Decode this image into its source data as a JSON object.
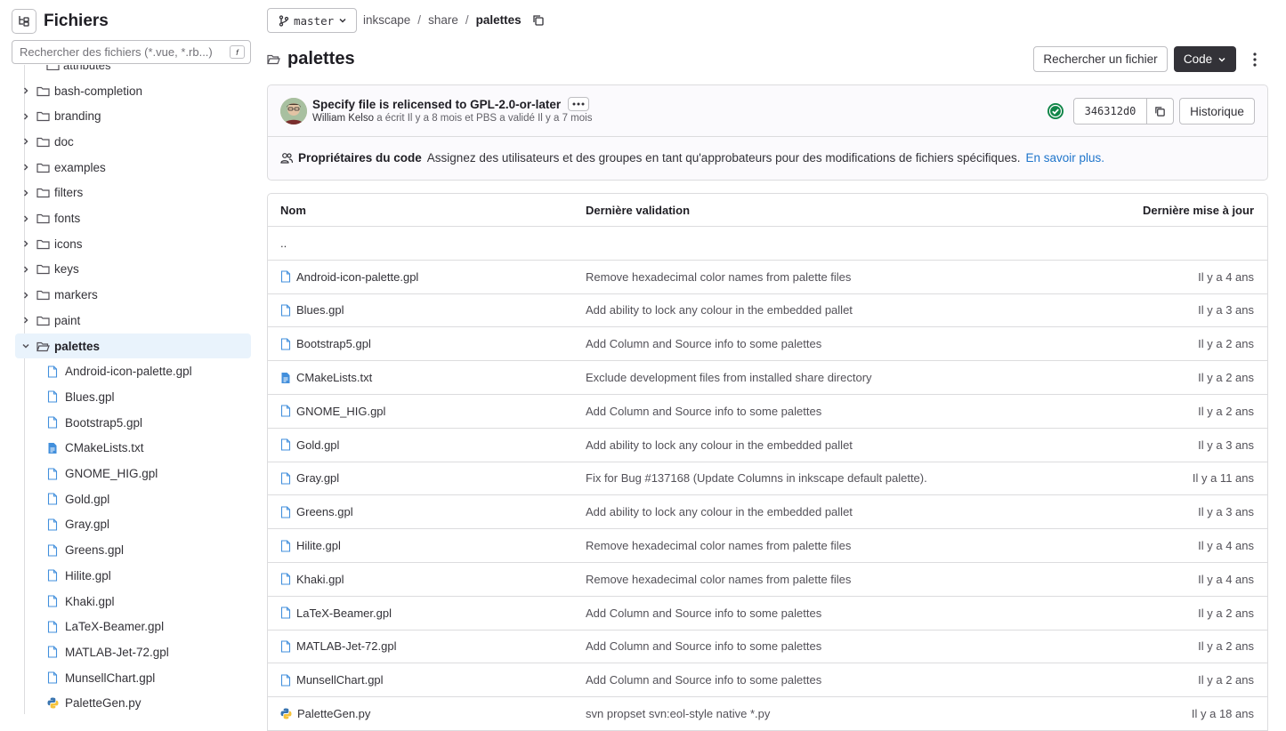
{
  "sidebar": {
    "title": "Fichiers",
    "search_placeholder": "Rechercher des fichiers (*.vue, *.rb...)",
    "shortcut": "f",
    "cut_item": "attributes",
    "folders": [
      "bash-completion",
      "branding",
      "doc",
      "examples",
      "filters",
      "fonts",
      "icons",
      "keys",
      "markers",
      "paint"
    ],
    "open_folder": "palettes",
    "files": [
      {
        "name": "Android-icon-palette.gpl",
        "icon": "file-icon"
      },
      {
        "name": "Blues.gpl",
        "icon": "file-icon"
      },
      {
        "name": "Bootstrap5.gpl",
        "icon": "file-icon"
      },
      {
        "name": "CMakeLists.txt",
        "icon": "file-text-icon"
      },
      {
        "name": "GNOME_HIG.gpl",
        "icon": "file-icon"
      },
      {
        "name": "Gold.gpl",
        "icon": "file-icon"
      },
      {
        "name": "Gray.gpl",
        "icon": "file-icon"
      },
      {
        "name": "Greens.gpl",
        "icon": "file-icon"
      },
      {
        "name": "Hilite.gpl",
        "icon": "file-icon"
      },
      {
        "name": "Khaki.gpl",
        "icon": "file-icon"
      },
      {
        "name": "LaTeX-Beamer.gpl",
        "icon": "file-icon"
      },
      {
        "name": "MATLAB-Jet-72.gpl",
        "icon": "file-icon"
      },
      {
        "name": "MunsellChart.gpl",
        "icon": "file-icon"
      },
      {
        "name": "PaletteGen.py",
        "icon": "python-icon"
      }
    ]
  },
  "topbar": {
    "branch": "master",
    "crumbs": [
      "inkscape",
      "share",
      "palettes"
    ]
  },
  "page": {
    "title": "palettes",
    "find_file": "Rechercher un fichier",
    "code_button": "Code"
  },
  "commit": {
    "title": "Specify file is relicensed to GPL-2.0-or-later",
    "author": "William Kelso",
    "meta_rest": " a écrit Il y a 8 mois et PBS a validé Il y a 7 mois",
    "sha": "346312d0",
    "history": "Historique",
    "owners_label": "Propriétaires du code",
    "owners_text": "Assignez des utilisateurs et des groupes en tant qu'approbateurs pour des modifications de fichiers spécifiques.",
    "owners_link": "En savoir plus."
  },
  "table": {
    "headers": [
      "Nom",
      "Dernière validation",
      "Dernière mise à jour"
    ],
    "parent": "..",
    "rows": [
      {
        "name": "Android-icon-palette.gpl",
        "icon": "file-icon",
        "commit": "Remove hexadecimal color names from palette files",
        "date": "Il y a 4 ans"
      },
      {
        "name": "Blues.gpl",
        "icon": "file-icon",
        "commit": "Add ability to lock any colour in the embedded pallet",
        "date": "Il y a 3 ans"
      },
      {
        "name": "Bootstrap5.gpl",
        "icon": "file-icon",
        "commit": "Add Column and Source info to some palettes",
        "date": "Il y a 2 ans"
      },
      {
        "name": "CMakeLists.txt",
        "icon": "file-text-icon",
        "commit": "Exclude development files from installed share directory",
        "date": "Il y a 2 ans"
      },
      {
        "name": "GNOME_HIG.gpl",
        "icon": "file-icon",
        "commit": "Add Column and Source info to some palettes",
        "date": "Il y a 2 ans"
      },
      {
        "name": "Gold.gpl",
        "icon": "file-icon",
        "commit": "Add ability to lock any colour in the embedded pallet",
        "date": "Il y a 3 ans"
      },
      {
        "name": "Gray.gpl",
        "icon": "file-icon",
        "commit": "Fix for Bug #137168 (Update Columns in inkscape default palette).",
        "date": "Il y a 11 ans"
      },
      {
        "name": "Greens.gpl",
        "icon": "file-icon",
        "commit": "Add ability to lock any colour in the embedded pallet",
        "date": "Il y a 3 ans"
      },
      {
        "name": "Hilite.gpl",
        "icon": "file-icon",
        "commit": "Remove hexadecimal color names from palette files",
        "date": "Il y a 4 ans"
      },
      {
        "name": "Khaki.gpl",
        "icon": "file-icon",
        "commit": "Remove hexadecimal color names from palette files",
        "date": "Il y a 4 ans"
      },
      {
        "name": "LaTeX-Beamer.gpl",
        "icon": "file-icon",
        "commit": "Add Column and Source info to some palettes",
        "date": "Il y a 2 ans"
      },
      {
        "name": "MATLAB-Jet-72.gpl",
        "icon": "file-icon",
        "commit": "Add Column and Source info to some palettes",
        "date": "Il y a 2 ans"
      },
      {
        "name": "MunsellChart.gpl",
        "icon": "file-icon",
        "commit": "Add Column and Source info to some palettes",
        "date": "Il y a 2 ans"
      },
      {
        "name": "PaletteGen.py",
        "icon": "python-icon",
        "commit": "svn propset svn:eol-style native *.py",
        "date": "Il y a 18 ans"
      }
    ]
  },
  "colors": {
    "accent": "#1f75cb",
    "selected_bg": "#e9f3fc",
    "success": "#108548",
    "dark_button": "#333238"
  }
}
